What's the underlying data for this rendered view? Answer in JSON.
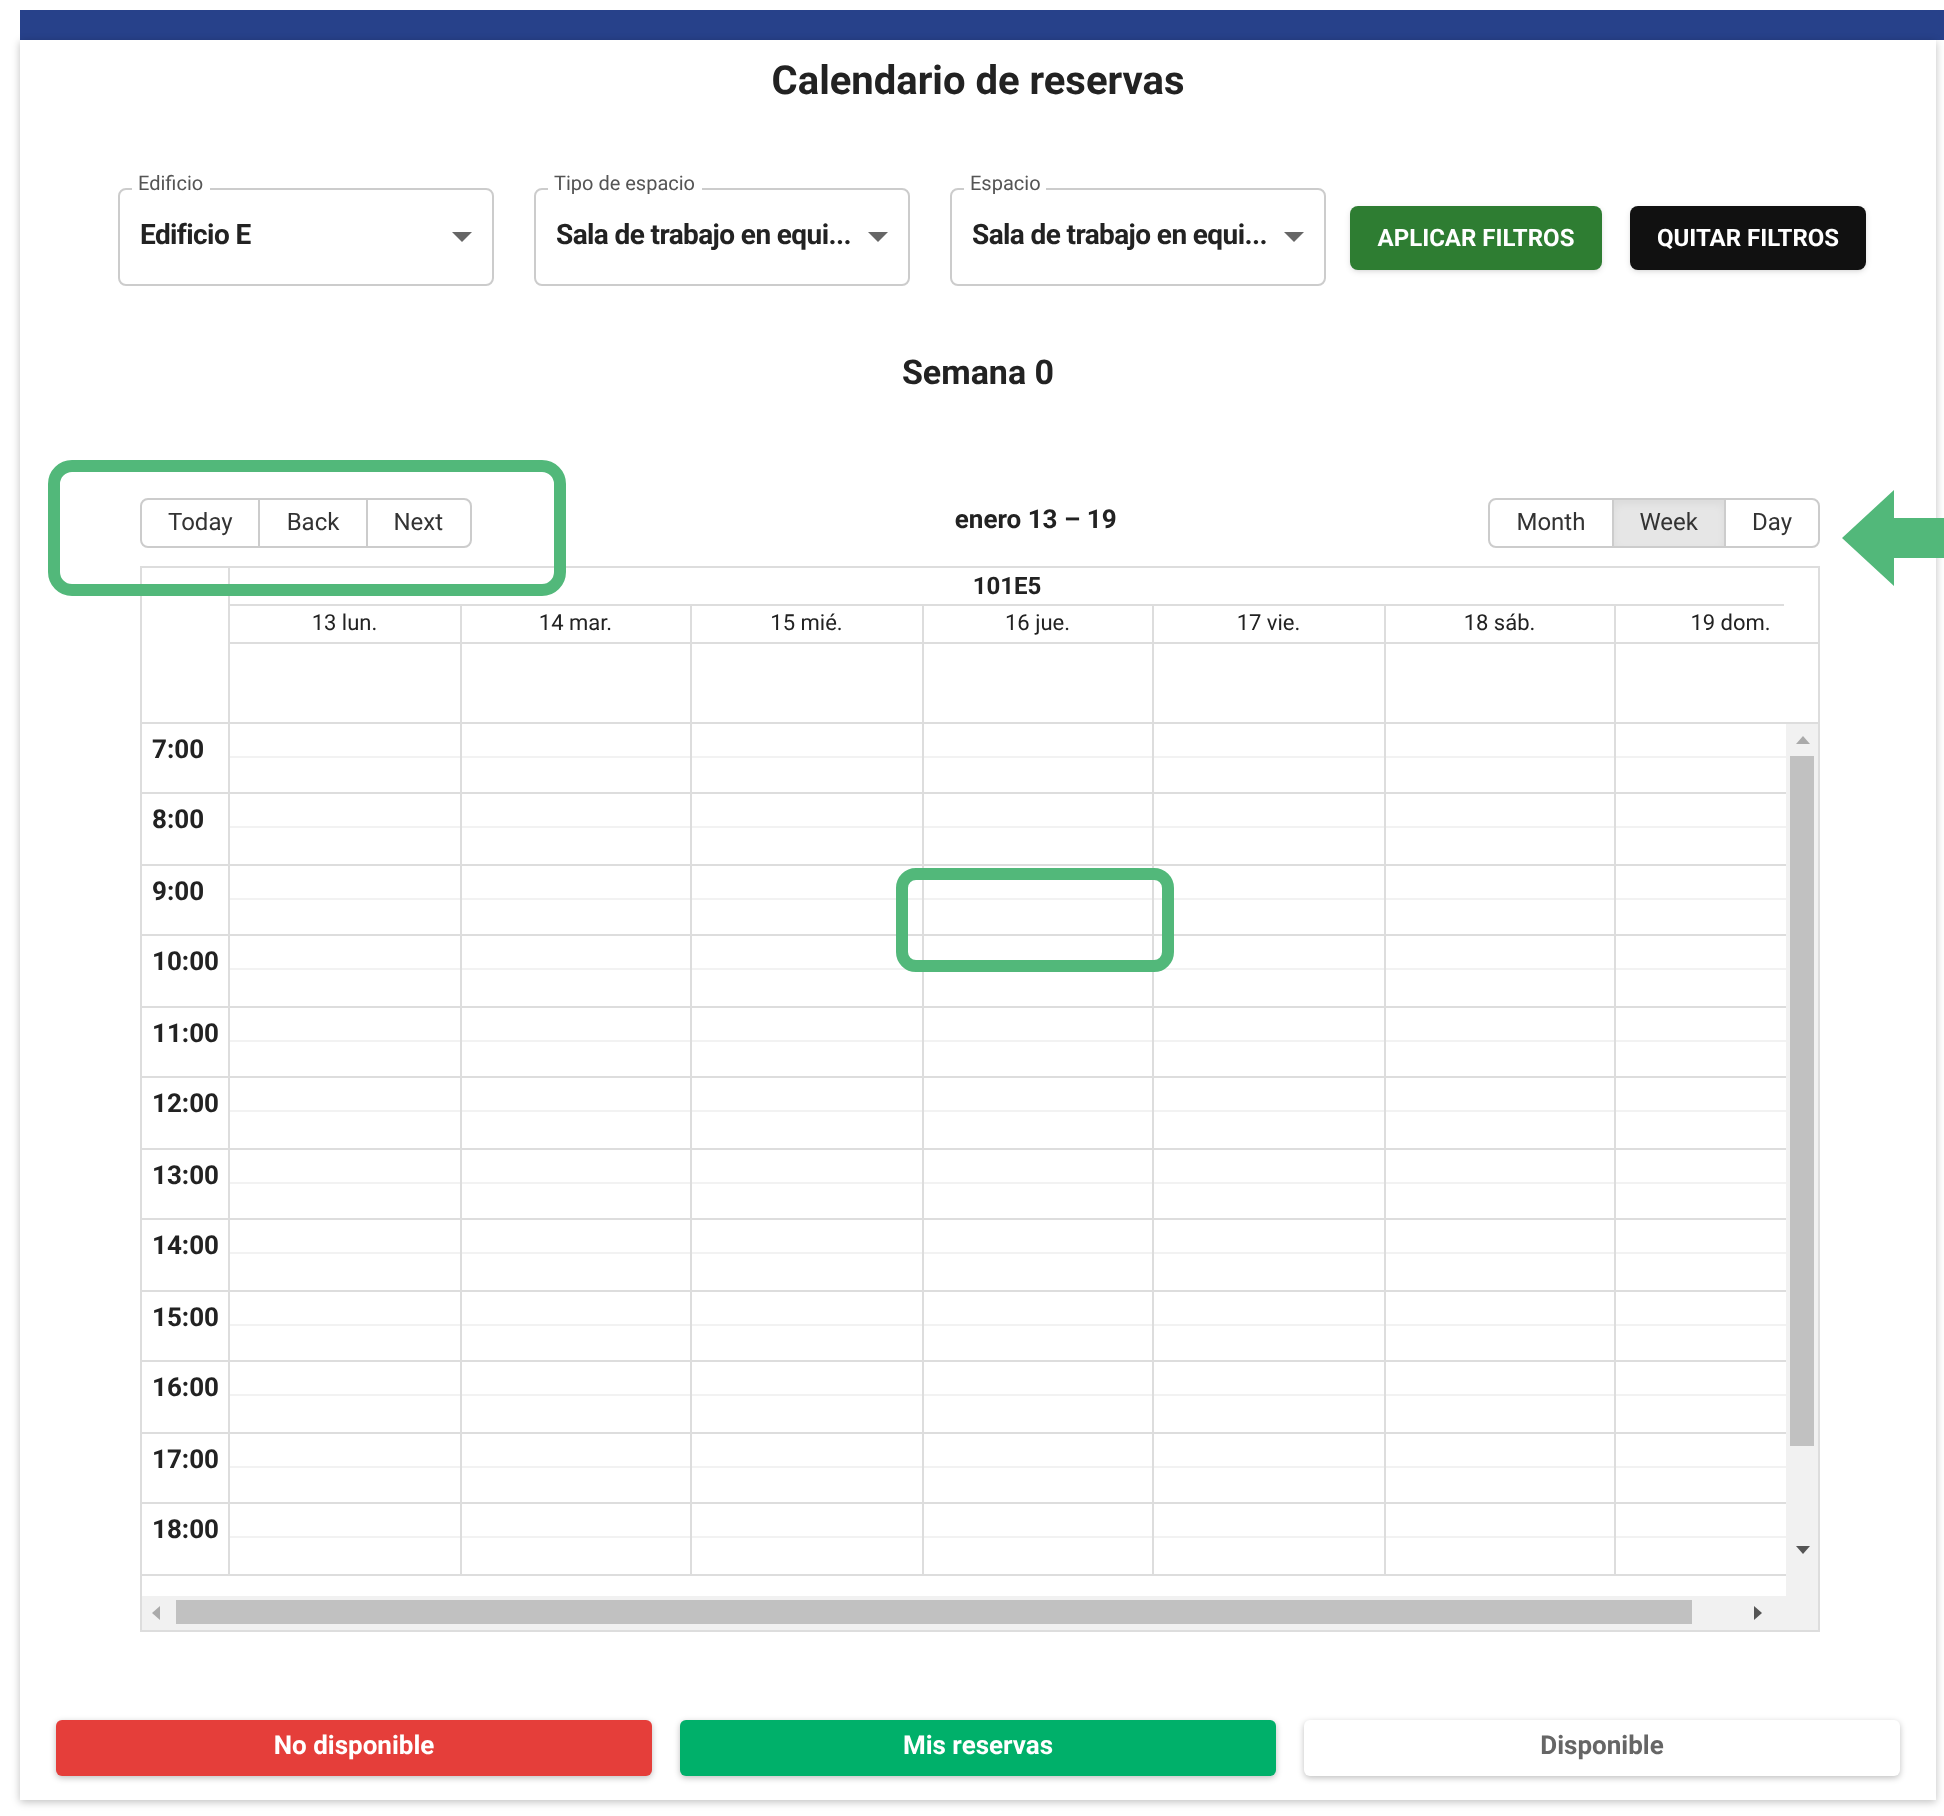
{
  "title": "Calendario de reservas",
  "filters": [
    {
      "label": "Edificio",
      "value": "Edificio E"
    },
    {
      "label": "Tipo de espacio",
      "value": "Sala de trabajo en equi..."
    },
    {
      "label": "Espacio",
      "value": "Sala de trabajo en equi..."
    }
  ],
  "filter_buttons": [
    {
      "kind": "apply",
      "label": "APLICAR FILTROS"
    },
    {
      "kind": "clear",
      "label": "QUITAR FILTROS"
    }
  ],
  "week_label": "Semana 0",
  "toolbar": {
    "nav": [
      "Today",
      "Back",
      "Next"
    ],
    "range": "enero 13 – 19",
    "views": [
      {
        "label": "Month",
        "selected": false
      },
      {
        "label": "Week",
        "selected": true
      },
      {
        "label": "Day",
        "selected": false
      }
    ]
  },
  "calendar": {
    "resource": "101E5",
    "days": [
      "13 lun.",
      "14 mar.",
      "15 mié.",
      "16 jue.",
      "17 vie.",
      "18 sáb.",
      "19 dom."
    ],
    "hours": [
      "7:00",
      "8:00",
      "9:00",
      "10:00",
      "11:00",
      "12:00",
      "13:00",
      "14:00",
      "15:00",
      "16:00",
      "17:00",
      "18:00"
    ]
  },
  "legend": [
    {
      "label": "No disponible",
      "color": "#e53e3a"
    },
    {
      "label": "Mis reservas",
      "color": "#00b06a"
    },
    {
      "label": "Disponible",
      "color": "#ffffff"
    }
  ]
}
